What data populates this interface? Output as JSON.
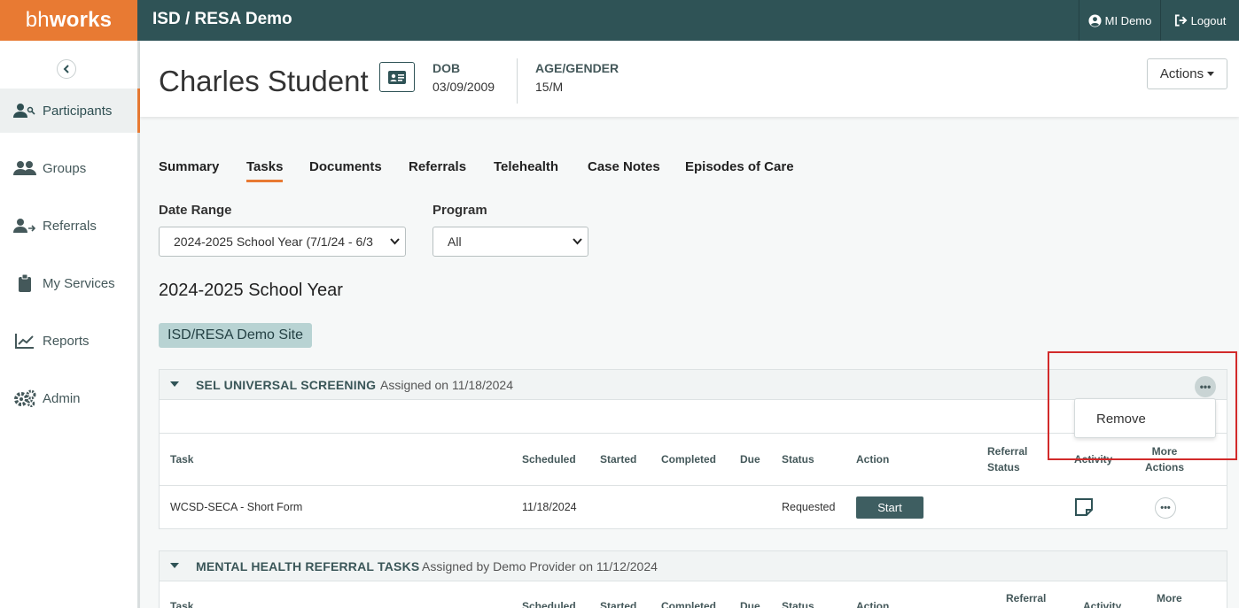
{
  "app": {
    "logo_light": "bh",
    "logo_bold": "works",
    "title": "ISD / RESA Demo",
    "user": "MI Demo",
    "logout": "Logout"
  },
  "sidebar": {
    "items": [
      {
        "label": "Participants",
        "icon": "participants-icon"
      },
      {
        "label": "Groups",
        "icon": "groups-icon"
      },
      {
        "label": "Referrals",
        "icon": "referrals-icon"
      },
      {
        "label": "My Services",
        "icon": "clipboard-icon"
      },
      {
        "label": "Reports",
        "icon": "chart-icon"
      },
      {
        "label": "Admin",
        "icon": "gears-icon"
      }
    ]
  },
  "header": {
    "name": "Charles Student",
    "dob_label": "DOB",
    "dob_value": "03/09/2009",
    "age_label": "AGE/GENDER",
    "age_value": "15/M",
    "actions_label": "Actions"
  },
  "tabs": [
    "Summary",
    "Tasks",
    "Documents",
    "Referrals",
    "Telehealth",
    "Case Notes",
    "Episodes of Care"
  ],
  "filters": {
    "date_range_label": "Date Range",
    "date_range_value": "2024-2025 School Year (7/1/24 - 6/3",
    "program_label": "Program",
    "program_value": "All"
  },
  "year_heading": "2024-2025 School Year",
  "site_badge": "ISD/RESA Demo Site",
  "panel1": {
    "title": "SEL UNIVERSAL SCREENING",
    "subtitle": "Assigned on 11/18/2024",
    "columns": [
      "Task",
      "Scheduled",
      "Started",
      "Completed",
      "Due",
      "Status",
      "Action",
      "Referral",
      "Status",
      "Activity",
      "More",
      "Actions"
    ],
    "row": {
      "task": "WCSD-SECA - Short Form",
      "scheduled": "11/18/2024",
      "status": "Requested",
      "action": "Start"
    },
    "dropdown_item": "Remove"
  },
  "panel2": {
    "title": "MENTAL HEALTH REFERRAL TASKS",
    "subtitle": "Assigned by Demo Provider on 11/12/2024",
    "columns": [
      "Task",
      "Scheduled",
      "Started",
      "Completed",
      "Due",
      "Status",
      "Action",
      "Referral",
      "Activity",
      "More"
    ]
  }
}
